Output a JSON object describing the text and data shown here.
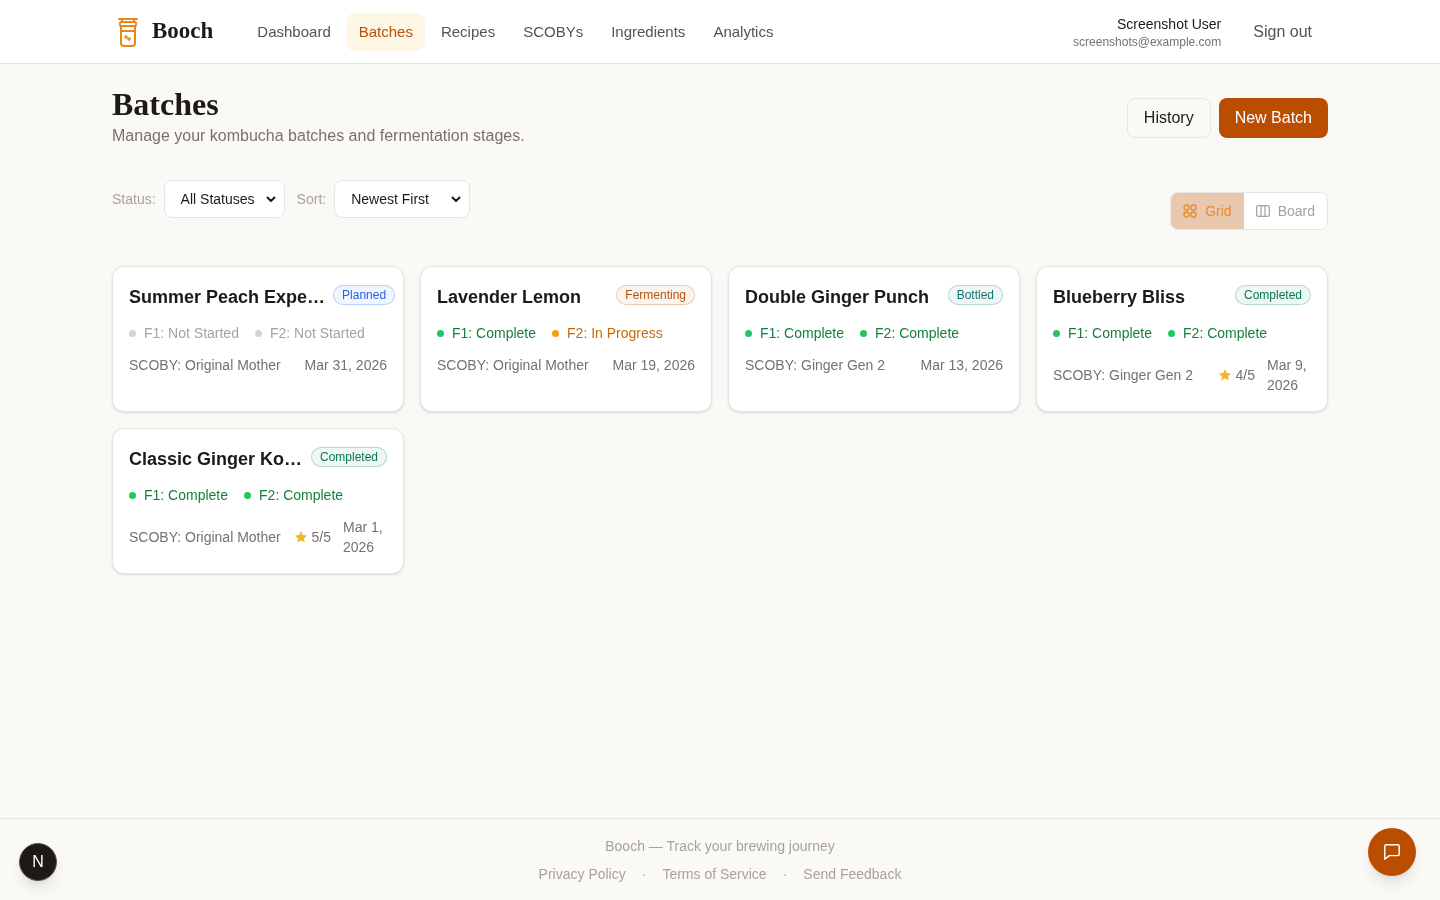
{
  "header": {
    "logo": "Booch",
    "nav": [
      {
        "label": "Dashboard",
        "selected": false
      },
      {
        "label": "Batches",
        "selected": true
      },
      {
        "label": "Recipes",
        "selected": false
      },
      {
        "label": "SCOBYs",
        "selected": false
      },
      {
        "label": "Ingredients",
        "selected": false
      },
      {
        "label": "Analytics",
        "selected": false
      }
    ],
    "user": {
      "name": "Screenshot User",
      "email": "screenshots@example.com"
    },
    "sign_out": "Sign out"
  },
  "page": {
    "title": "Batches",
    "subtitle": "Manage your kombucha batches and fermentation stages.",
    "actions": [
      {
        "label": "History",
        "kind": "secondary"
      },
      {
        "label": "New Batch",
        "kind": "primary"
      }
    ]
  },
  "filters": [
    {
      "label": "Status:",
      "value": "All Statuses"
    },
    {
      "label": "Sort:",
      "value": "Newest First"
    }
  ],
  "view_toggle": [
    {
      "label": "Grid",
      "kind": "grid",
      "selected": true
    },
    {
      "label": "Board",
      "kind": "board",
      "selected": false
    }
  ],
  "batches": [
    {
      "name": "Summer Peach Expe…",
      "status": {
        "label": "Planned",
        "color": "#2563eb"
      },
      "stages": [
        {
          "label": "F1: Not Started",
          "color": "#d4d4d4"
        },
        {
          "label": "F2: Not Started",
          "color": "#d4d4d4"
        }
      ],
      "scoby": "SCOBY: Original Mother",
      "date": "Mar 31, 2026"
    },
    {
      "name": "Lavender Lemon",
      "status": {
        "label": "Fermenting",
        "color": "#b45309"
      },
      "stages": [
        {
          "label": "F1: Complete",
          "color": "#22c55e"
        },
        {
          "label": "F2: In Progress",
          "color": "#f59e0b"
        }
      ],
      "scoby": "SCOBY: Original Mother",
      "date": "Mar 19, 2026"
    },
    {
      "name": "Double Ginger Punch",
      "status": {
        "label": "Bottled",
        "color": "#0f766e"
      },
      "stages": [
        {
          "label": "F1: Complete",
          "color": "#22c55e"
        },
        {
          "label": "F2: Complete",
          "color": "#22c55e"
        }
      ],
      "scoby": "SCOBY: Ginger Gen 2",
      "date": "Mar 13, 2026"
    },
    {
      "name": "Blueberry Bliss",
      "status": {
        "label": "Completed",
        "color": "#047857"
      },
      "stages": [
        {
          "label": "F1: Complete",
          "color": "#22c55e"
        },
        {
          "label": "F2: Complete",
          "color": "#22c55e"
        }
      ],
      "scoby": "SCOBY: Ginger Gen 2",
      "rating": "4/5",
      "date": "Mar 9, 2026"
    },
    {
      "name": "Classic Ginger Ko…",
      "status": {
        "label": "Completed",
        "color": "#047857"
      },
      "stages": [
        {
          "label": "F1: Complete",
          "color": "#22c55e"
        },
        {
          "label": "F2: Complete",
          "color": "#22c55e"
        }
      ],
      "scoby": "SCOBY: Original Mother",
      "rating": "5/5",
      "date": "Mar 1, 2026"
    }
  ],
  "footer": {
    "tagline": "Booch — Track your brewing journey",
    "links": [
      "Privacy Policy",
      "Terms of Service",
      "Send Feedback"
    ],
    "separators": [
      "·",
      "·"
    ]
  },
  "dev_badge": "N"
}
